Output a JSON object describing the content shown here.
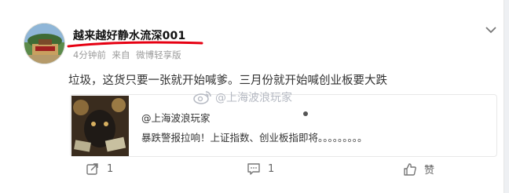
{
  "post": {
    "username": "越来越好静水流深001",
    "meta": {
      "time": "4分钟前",
      "source_label": "来自",
      "source": "微博轻享版"
    },
    "text": "垃圾，这货只要一张就开始喊爹。三月份就开始喊创业板要大跌",
    "watermark": "@上海波浪玩家"
  },
  "quote": {
    "author": "@上海波浪玩家",
    "text": "暴跌警报拉响！上证指数、创业板指即将。。。。。。。。。"
  },
  "actions": {
    "repost_count": "1",
    "comment_count": "1",
    "like_label": "赞"
  },
  "colors": {
    "underline": "#e60012",
    "text": "#333333",
    "meta": "#9b9b9b",
    "watermark": "#b5b9c2"
  },
  "icons": [
    "chevron-down-icon",
    "weibo-logo-icon",
    "repost-icon",
    "comment-icon",
    "like-icon"
  ]
}
